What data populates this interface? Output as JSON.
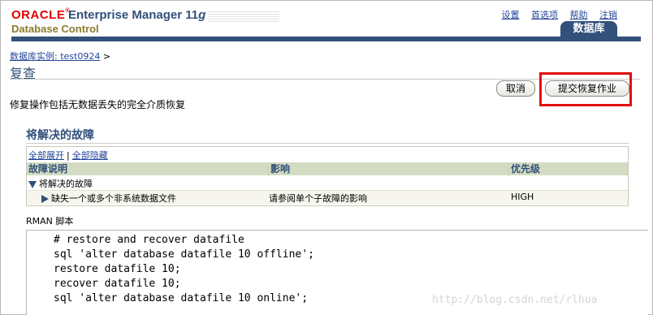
{
  "header": {
    "oracle": "ORACLE",
    "product": "Enterprise Manager 11",
    "version_suffix": "g",
    "subtitle": "Database Control",
    "links": [
      "设置",
      "首选项",
      "帮助",
      "注销"
    ],
    "tab": "数据库"
  },
  "breadcrumb": {
    "link": "数据库实例: test0924",
    "sep": ">"
  },
  "page_title": "复查",
  "buttons": {
    "cancel": "取消",
    "submit": "提交恢复作业"
  },
  "description": "修复操作包括无数据丢失的完全介质恢复",
  "section": {
    "title": "将解决的故障",
    "expand_all": "全部展开",
    "separator": "|",
    "collapse_all": "全部隐藏",
    "columns": [
      "故障说明",
      "影响",
      "优先级"
    ],
    "rows": [
      {
        "desc": "将解决的故障",
        "impact": "",
        "priority": ""
      },
      {
        "desc": "缺失一个或多个非系统数据文件",
        "impact": "请参阅单个子故障的影响",
        "priority": "HIGH"
      }
    ]
  },
  "script": {
    "label": "RMAN 脚本",
    "lines": [
      "# restore and recover datafile",
      "sql 'alter database datafile 10 offline';",
      "restore datafile 10;",
      "recover datafile 10;",
      "sql 'alter database datafile 10 online';"
    ]
  },
  "watermark": "http://blog.csdn.net/rlhua",
  "colors": {
    "brand_blue": "#31507a",
    "oracle_red": "#e00000",
    "highlight_red": "#e01010",
    "header_row": "#d3dcc2"
  }
}
